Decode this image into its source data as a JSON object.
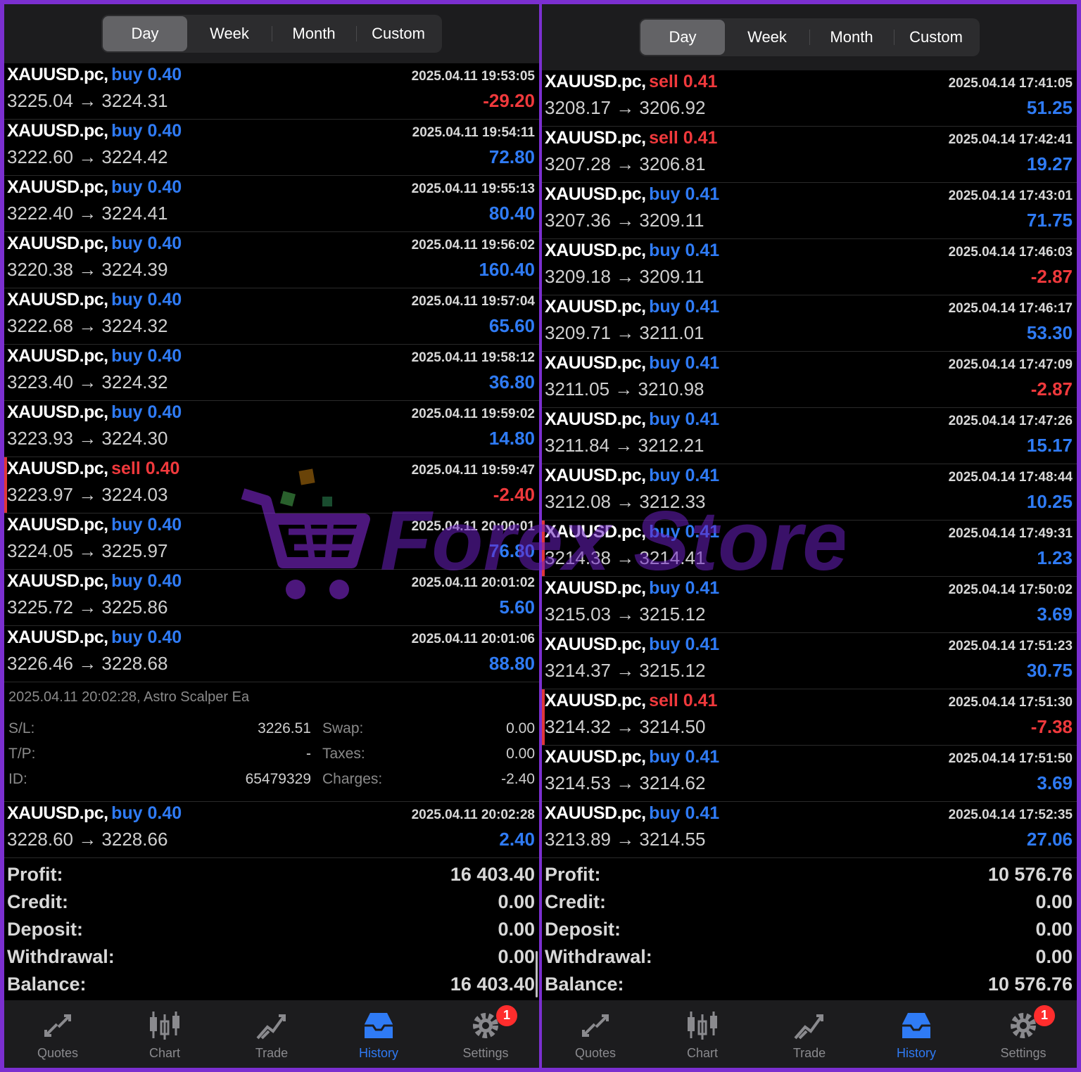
{
  "tabs": [
    "Day",
    "Week",
    "Month",
    "Custom"
  ],
  "left": {
    "active_tab": 0,
    "deals": [
      {
        "symbol": "XAUUSD.pc,",
        "side": "buy",
        "volume": "buy 0.40",
        "time": "2025.04.11 19:53:05",
        "prices": "3225.04 → 3224.31",
        "profit": "-29.20"
      },
      {
        "symbol": "XAUUSD.pc,",
        "side": "buy",
        "volume": "buy 0.40",
        "time": "2025.04.11 19:54:11",
        "prices": "3222.60 → 3224.42",
        "profit": "72.80"
      },
      {
        "symbol": "XAUUSD.pc,",
        "side": "buy",
        "volume": "buy 0.40",
        "time": "2025.04.11 19:55:13",
        "prices": "3222.40 → 3224.41",
        "profit": "80.40"
      },
      {
        "symbol": "XAUUSD.pc,",
        "side": "buy",
        "volume": "buy 0.40",
        "time": "2025.04.11 19:56:02",
        "prices": "3220.38 → 3224.39",
        "profit": "160.40"
      },
      {
        "symbol": "XAUUSD.pc,",
        "side": "buy",
        "volume": "buy 0.40",
        "time": "2025.04.11 19:57:04",
        "prices": "3222.68 → 3224.32",
        "profit": "65.60"
      },
      {
        "symbol": "XAUUSD.pc,",
        "side": "buy",
        "volume": "buy 0.40",
        "time": "2025.04.11 19:58:12",
        "prices": "3223.40 → 3224.32",
        "profit": "36.80"
      },
      {
        "symbol": "XAUUSD.pc,",
        "side": "buy",
        "volume": "buy 0.40",
        "time": "2025.04.11 19:59:02",
        "prices": "3223.93 → 3224.30",
        "profit": "14.80"
      },
      {
        "symbol": "XAUUSD.pc,",
        "side": "sell",
        "volume": "sell 0.40",
        "time": "2025.04.11 19:59:47",
        "prices": "3223.97 → 3224.03",
        "profit": "-2.40",
        "marked": true
      },
      {
        "symbol": "XAUUSD.pc,",
        "side": "buy",
        "volume": "buy 0.40",
        "time": "2025.04.11 20:00:01",
        "prices": "3224.05 → 3225.97",
        "profit": "76.80"
      },
      {
        "symbol": "XAUUSD.pc,",
        "side": "buy",
        "volume": "buy 0.40",
        "time": "2025.04.11 20:01:02",
        "prices": "3225.72 → 3225.86",
        "profit": "5.60"
      },
      {
        "symbol": "XAUUSD.pc,",
        "side": "buy",
        "volume": "buy 0.40",
        "time": "2025.04.11 20:01:06",
        "prices": "3226.46 → 3228.68",
        "profit": "88.80"
      }
    ],
    "detail": {
      "header": "2025.04.11 20:02:28, Astro Scalper Ea",
      "rows": [
        {
          "k1": "S/L:",
          "v1": "3226.51",
          "k2": "Swap:",
          "v2": "0.00"
        },
        {
          "k1": "T/P:",
          "v1": "-",
          "k2": "Taxes:",
          "v2": "0.00"
        },
        {
          "k1": "ID:",
          "v1": "65479329",
          "k2": "Charges:",
          "v2": "-2.40"
        }
      ]
    },
    "last_deal": {
      "symbol": "XAUUSD.pc,",
      "side": "buy",
      "volume": "buy 0.40",
      "time": "2025.04.11 20:02:28",
      "prices": "3228.60 → 3228.66",
      "profit": "2.40"
    },
    "summary": [
      {
        "label": "Profit:",
        "value": "16 403.40"
      },
      {
        "label": "Credit:",
        "value": "0.00"
      },
      {
        "label": "Deposit:",
        "value": "0.00"
      },
      {
        "label": "Withdrawal:",
        "value": "0.00"
      },
      {
        "label": "Balance:",
        "value": "16 403.40"
      }
    ]
  },
  "right": {
    "active_tab": 0,
    "deals": [
      {
        "symbol": "XAUUSD.pc,",
        "side": "sell",
        "volume": "sell 0.41",
        "time": "2025.04.14 17:41:05",
        "prices": "3208.17 → 3206.92",
        "profit": "51.25"
      },
      {
        "symbol": "XAUUSD.pc,",
        "side": "sell",
        "volume": "sell 0.41",
        "time": "2025.04.14 17:42:41",
        "prices": "3207.28 → 3206.81",
        "profit": "19.27"
      },
      {
        "symbol": "XAUUSD.pc,",
        "side": "buy",
        "volume": "buy 0.41",
        "time": "2025.04.14 17:43:01",
        "prices": "3207.36 → 3209.11",
        "profit": "71.75"
      },
      {
        "symbol": "XAUUSD.pc,",
        "side": "buy",
        "volume": "buy 0.41",
        "time": "2025.04.14 17:46:03",
        "prices": "3209.18 → 3209.11",
        "profit": "-2.87"
      },
      {
        "symbol": "XAUUSD.pc,",
        "side": "buy",
        "volume": "buy 0.41",
        "time": "2025.04.14 17:46:17",
        "prices": "3209.71 → 3211.01",
        "profit": "53.30"
      },
      {
        "symbol": "XAUUSD.pc,",
        "side": "buy",
        "volume": "buy 0.41",
        "time": "2025.04.14 17:47:09",
        "prices": "3211.05 → 3210.98",
        "profit": "-2.87"
      },
      {
        "symbol": "XAUUSD.pc,",
        "side": "buy",
        "volume": "buy 0.41",
        "time": "2025.04.14 17:47:26",
        "prices": "3211.84 → 3212.21",
        "profit": "15.17"
      },
      {
        "symbol": "XAUUSD.pc,",
        "side": "buy",
        "volume": "buy 0.41",
        "time": "2025.04.14 17:48:44",
        "prices": "3212.08 → 3212.33",
        "profit": "10.25"
      },
      {
        "symbol": "XAUUSD.pc,",
        "side": "buy",
        "volume": "buy 0.41",
        "time": "2025.04.14 17:49:31",
        "prices": "3214.38 → 3214.41",
        "profit": "1.23",
        "marked": true
      },
      {
        "symbol": "XAUUSD.pc,",
        "side": "buy",
        "volume": "buy 0.41",
        "time": "2025.04.14 17:50:02",
        "prices": "3215.03 → 3215.12",
        "profit": "3.69"
      },
      {
        "symbol": "XAUUSD.pc,",
        "side": "buy",
        "volume": "buy 0.41",
        "time": "2025.04.14 17:51:23",
        "prices": "3214.37 → 3215.12",
        "profit": "30.75"
      },
      {
        "symbol": "XAUUSD.pc,",
        "side": "sell",
        "volume": "sell 0.41",
        "time": "2025.04.14 17:51:30",
        "prices": "3214.32 → 3214.50",
        "profit": "-7.38",
        "marked": true
      },
      {
        "symbol": "XAUUSD.pc,",
        "side": "buy",
        "volume": "buy 0.41",
        "time": "2025.04.14 17:51:50",
        "prices": "3214.53 → 3214.62",
        "profit": "3.69"
      },
      {
        "symbol": "XAUUSD.pc,",
        "side": "buy",
        "volume": "buy 0.41",
        "time": "2025.04.14 17:52:35",
        "prices": "3213.89 → 3214.55",
        "profit": "27.06"
      }
    ],
    "summary": [
      {
        "label": "Profit:",
        "value": "10 576.76"
      },
      {
        "label": "Credit:",
        "value": "0.00"
      },
      {
        "label": "Deposit:",
        "value": "0.00"
      },
      {
        "label": "Withdrawal:",
        "value": "0.00"
      },
      {
        "label": "Balance:",
        "value": "10 576.76"
      }
    ]
  },
  "nav": [
    {
      "label": "Quotes",
      "icon": "quotes-icon"
    },
    {
      "label": "Chart",
      "icon": "candlestick-chart-icon"
    },
    {
      "label": "Trade",
      "icon": "trade-icon"
    },
    {
      "label": "History",
      "icon": "history-icon",
      "active": true
    },
    {
      "label": "Settings",
      "icon": "gear-icon",
      "badge": "1"
    }
  ],
  "watermark": {
    "text": "Forex Store"
  },
  "colors": {
    "buy": "#2f7bf5",
    "sell": "#f0393c",
    "background": "#000000",
    "bar": "#1c1c1e",
    "frame": "#7b2fd0"
  }
}
